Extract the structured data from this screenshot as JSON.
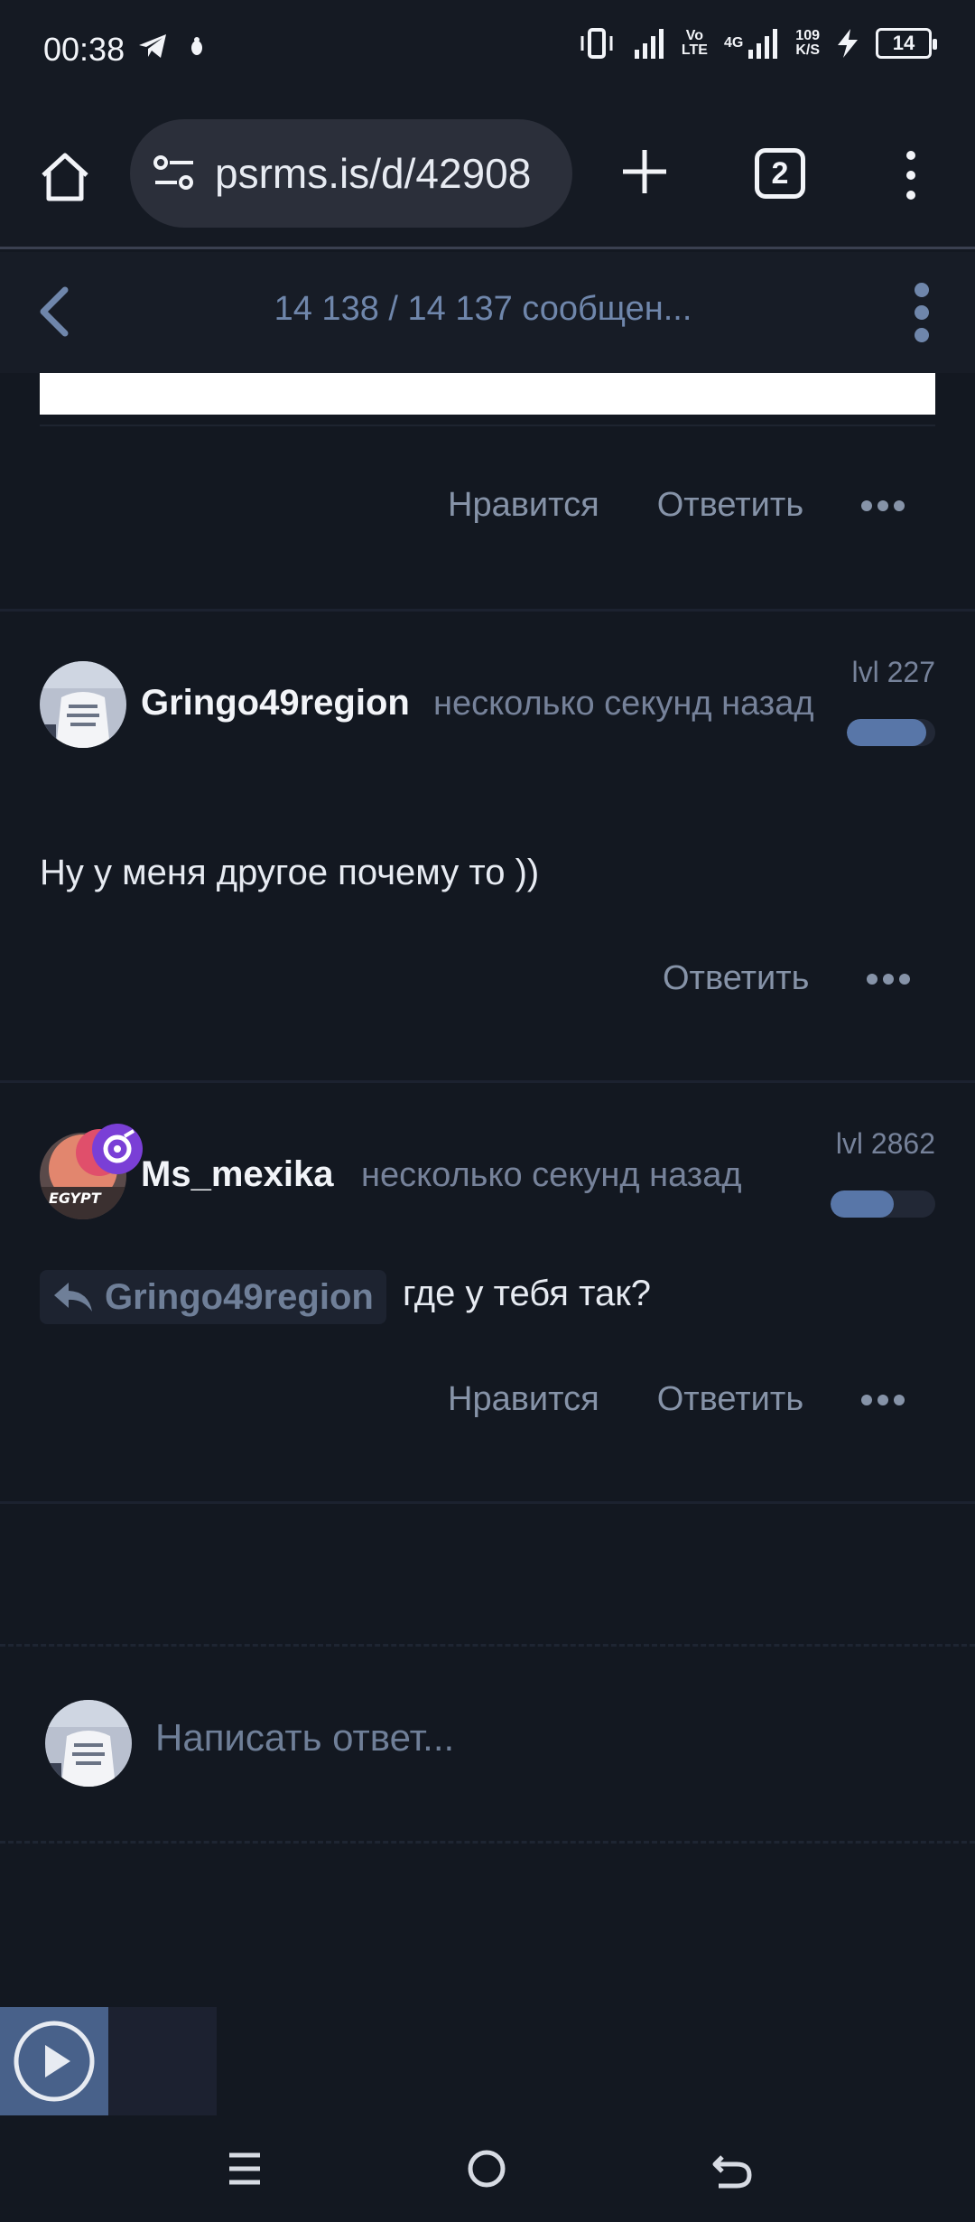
{
  "status_bar": {
    "time": "00:38",
    "network_speed_value": "109",
    "network_speed_unit": "K/S",
    "network_label_vo": "Vo",
    "network_label_lte": "LTE",
    "network_label_4g": "4G",
    "battery": "14"
  },
  "browser": {
    "url": "psrms.is/d/42908",
    "tab_count": "2"
  },
  "topic_header": {
    "title": "14 138 / 14 137 сообщен..."
  },
  "posts": [
    {
      "actions": {
        "like": "Нравится",
        "reply": "Ответить"
      }
    },
    {
      "username": "Gringo49region",
      "timestamp": "несколько секунд назад",
      "level": "lvl 227",
      "level_fill": 0.9,
      "text": "Ну у меня другое почему то ))",
      "actions": {
        "reply": "Ответить"
      }
    },
    {
      "username": "Ms_mexika",
      "timestamp": "несколько секунд назад",
      "level": "lvl 2862",
      "level_fill": 0.6,
      "reply_to": "Gringo49region",
      "text": "где у тебя так?",
      "actions": {
        "like": "Нравится",
        "reply": "Ответить"
      }
    }
  ],
  "reply_box": {
    "placeholder": "Написать ответ..."
  },
  "colors": {
    "background": "#131821",
    "accent": "#5876a8",
    "muted_text": "#8693a8"
  }
}
